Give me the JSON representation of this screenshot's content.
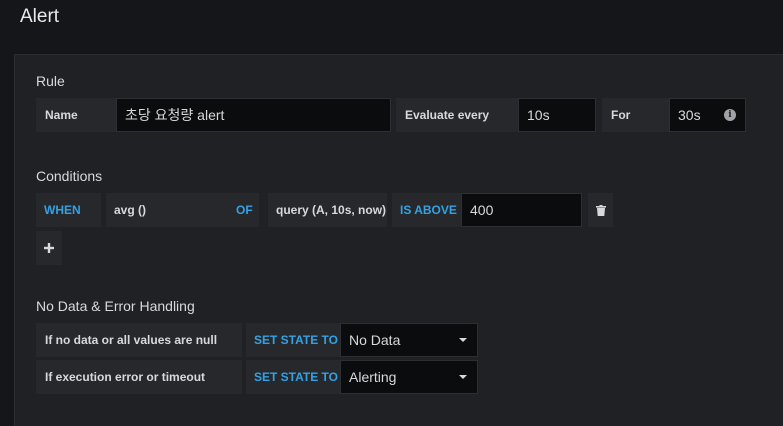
{
  "page": {
    "title": "Alert"
  },
  "rule": {
    "heading": "Rule",
    "name_label": "Name",
    "name_value": "초당 요청량 alert",
    "evaluate_label": "Evaluate every",
    "evaluate_value": "10s",
    "for_label": "For",
    "for_value": "30s"
  },
  "conditions": {
    "heading": "Conditions",
    "when": "WHEN",
    "reducer": "avg ()",
    "of": "OF",
    "query": "query (A, 10s, now)",
    "evaluator": "IS ABOVE",
    "threshold": "400",
    "add_icon": "plus-icon",
    "delete_icon": "trash-icon"
  },
  "nodata": {
    "heading": "No Data & Error Handling",
    "rows": [
      {
        "label": "If no data or all values are null",
        "set_state": "SET STATE TO",
        "value": "No Data"
      },
      {
        "label": "If execution error or timeout",
        "set_state": "SET STATE TO",
        "value": "Alerting"
      }
    ]
  },
  "colors": {
    "accent": "#33a2e5",
    "background": "#141619",
    "panel": "#1f2125"
  }
}
